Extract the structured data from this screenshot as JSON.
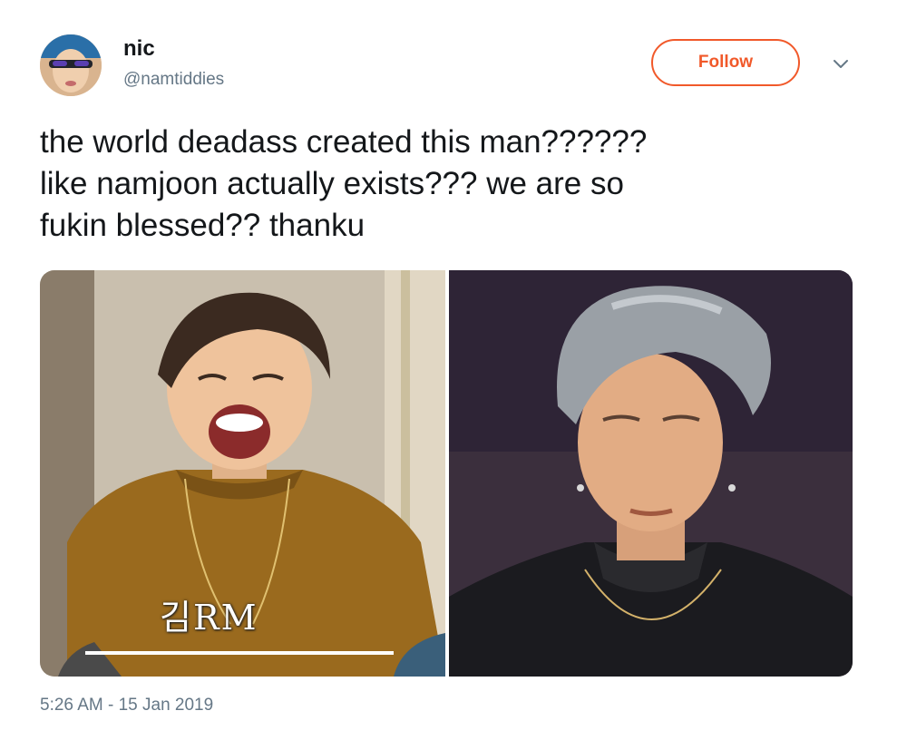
{
  "user": {
    "display_name": "nic",
    "handle": "@namtiddies"
  },
  "follow_button": {
    "label": "Follow",
    "accent_color": "#f1592a"
  },
  "caret_icon": "chevron-down-icon",
  "tweet": {
    "text_lines": [
      "the world deadass created this man??????",
      "like namjoon actually exists??? we are so",
      "fukin blessed?? thanku"
    ]
  },
  "media": {
    "left_photo_caption": "김RM"
  },
  "timestamp": "5:26 AM - 15 Jan 2019",
  "colors": {
    "text": "#14171a",
    "secondary_text": "#657786"
  }
}
